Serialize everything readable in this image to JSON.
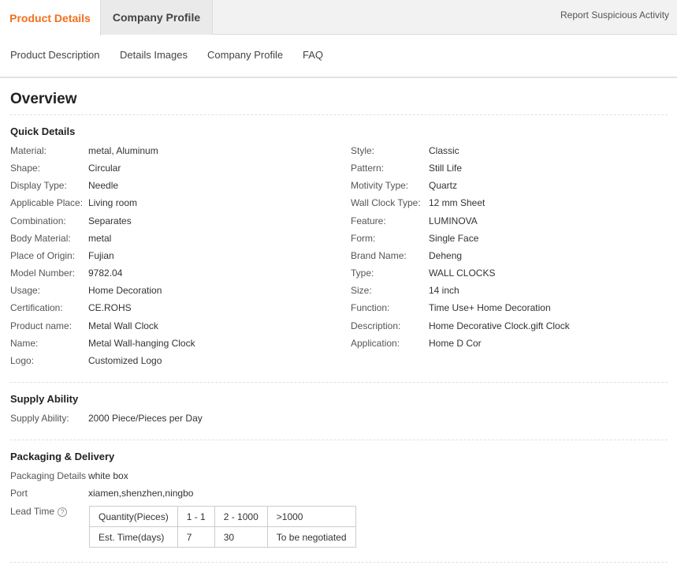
{
  "tabs": {
    "product_details": "Product Details",
    "company_profile": "Company Profile"
  },
  "report_link": "Report Suspicious Activity",
  "subnav": [
    "Product Description",
    "Details Images",
    "Company Profile",
    "FAQ"
  ],
  "overview": {
    "title": "Overview",
    "quick_details": {
      "title": "Quick Details",
      "left": [
        {
          "label": "Material:",
          "value": "metal, Aluminum"
        },
        {
          "label": "Shape:",
          "value": "Circular"
        },
        {
          "label": "Display Type:",
          "value": "Needle"
        },
        {
          "label": "Applicable Place:",
          "value": "Living room"
        },
        {
          "label": "Combination:",
          "value": "Separates"
        },
        {
          "label": "Body Material:",
          "value": "metal"
        },
        {
          "label": "Place of Origin:",
          "value": "Fujian"
        },
        {
          "label": "Model Number:",
          "value": "9782.04"
        },
        {
          "label": "Usage:",
          "value": "Home Decoration"
        },
        {
          "label": "Certification:",
          "value": "CE.ROHS"
        },
        {
          "label": "Product name:",
          "value": "Metal Wall Clock"
        },
        {
          "label": "Name:",
          "value": "Metal Wall-hanging Clock"
        },
        {
          "label": "Logo:",
          "value": "Customized Logo"
        }
      ],
      "right": [
        {
          "label": "Style:",
          "value": "Classic"
        },
        {
          "label": "Pattern:",
          "value": "Still Life"
        },
        {
          "label": "Motivity Type:",
          "value": "Quartz"
        },
        {
          "label": "Wall Clock Type:",
          "value": "12 mm Sheet"
        },
        {
          "label": "Feature:",
          "value": "LUMINOVA"
        },
        {
          "label": "Form:",
          "value": "Single Face"
        },
        {
          "label": "Brand Name:",
          "value": "Deheng"
        },
        {
          "label": "Type:",
          "value": "WALL CLOCKS"
        },
        {
          "label": "Size:",
          "value": "14 inch"
        },
        {
          "label": "Function:",
          "value": "Time Use+ Home Decoration"
        },
        {
          "label": "Description:",
          "value": "Home Decorative Clock.gift Clock"
        },
        {
          "label": "Application:",
          "value": "Home D Cor"
        }
      ]
    },
    "supply": {
      "title": "Supply Ability",
      "label": "Supply Ability:",
      "value": "2000 Piece/Pieces per Day"
    },
    "packaging": {
      "title": "Packaging & Delivery",
      "details_label": "Packaging Details",
      "details_value": "white box",
      "port_label": "Port",
      "port_value": "xiamen,shenzhen,ningbo",
      "lead_label": "Lead Time",
      "help_icon": "question-circle-icon",
      "lead_table": {
        "row1": [
          "Quantity(Pieces)",
          "1 - 1",
          "2 - 1000",
          ">1000"
        ],
        "row2": [
          "Est. Time(days)",
          "7",
          "30",
          "To be negotiated"
        ]
      }
    }
  }
}
